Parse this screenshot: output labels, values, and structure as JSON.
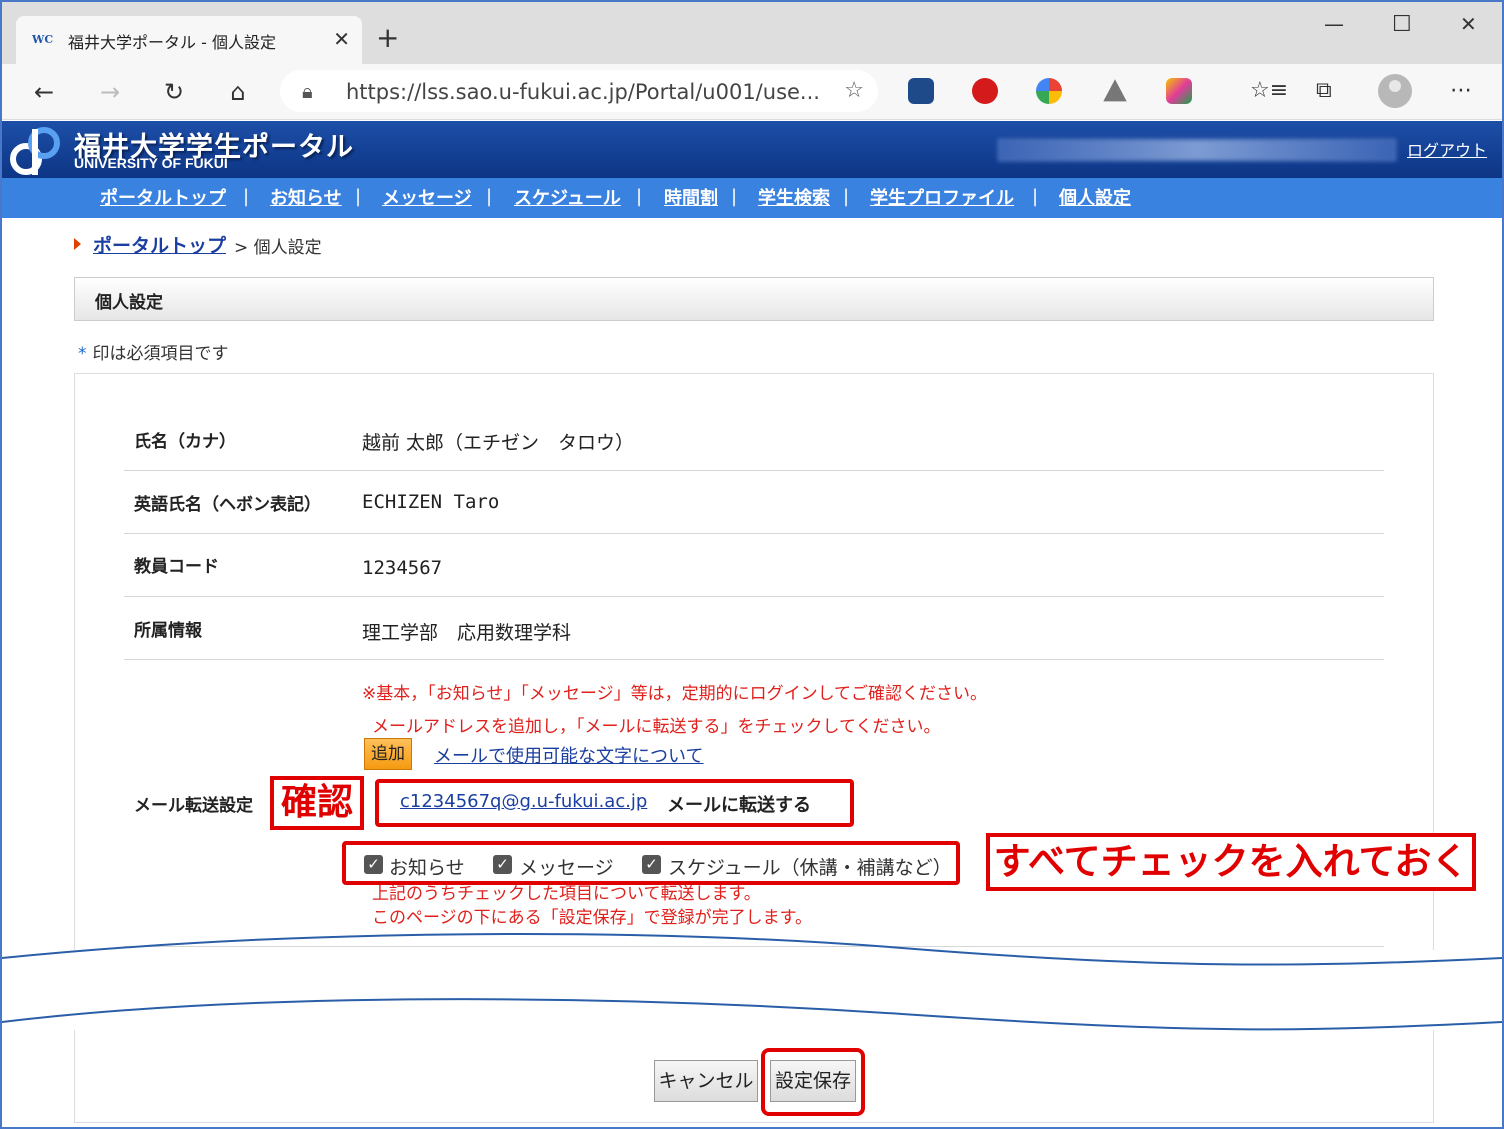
{
  "browser": {
    "tab_title": "福井大学ポータル - 個人設定",
    "favicon_text": "WC",
    "url": "https://lss.sao.u-fukui.ac.jp/Portal/u001/use..."
  },
  "portal": {
    "title": "福井大学学生ポータル",
    "subtitle": "UNIVERSITY OF FUKUI",
    "logout": "ログアウト"
  },
  "menu": [
    {
      "label": "ポータルトップ"
    },
    {
      "label": "お知らせ"
    },
    {
      "label": "メッセージ"
    },
    {
      "label": "スケジュール"
    },
    {
      "label": "時間割"
    },
    {
      "label": "学生検索"
    },
    {
      "label": "学生プロファイル"
    },
    {
      "label": "個人設定"
    }
  ],
  "breadcrumb": {
    "link": "ポータルトップ",
    "separator": ">",
    "current": "個人設定"
  },
  "section_title": "個人設定",
  "required_note": {
    "mark": "*",
    "text": "印は必須項目です"
  },
  "fields": {
    "name_kana": {
      "label": "氏名（カナ）",
      "value": "越前 太郎（エチゼン　タロウ）"
    },
    "name_en": {
      "label": "英語氏名（ヘボン表記）",
      "value": "ECHIZEN Taro"
    },
    "staff_code": {
      "label": "教員コード",
      "value": "1234567"
    },
    "affiliation": {
      "label": "所属情報",
      "value": "理工学部　応用数理学科"
    }
  },
  "mail": {
    "label": "メール転送設定",
    "notice1": "※基本，「お知らせ」「メッセージ」等は，定期的にログインしてご確認ください。",
    "notice2": "メールアドレスを追加し，「メールに転送する」をチェックしてください。",
    "add_button": "追加",
    "char_link": "メールで使用可能な文字について",
    "email": "c1234567q@g.u-fukui.ac.jp",
    "forward_label": "メールに転送する",
    "checks": [
      {
        "label": "お知らせ",
        "checked": true
      },
      {
        "label": "メッセージ",
        "checked": true
      },
      {
        "label": "スケジュール（休講・補講など）",
        "checked": true
      }
    ],
    "note3": "上記のうちチェックした項目について転送します。",
    "note4": "このページの下にある「設定保存」で登録が完了します。"
  },
  "annotations": {
    "confirm": "確認",
    "check_all": "すべてチェックを入れておく",
    "color": "#e00000"
  },
  "buttons": {
    "cancel": "キャンセル",
    "save": "設定保存"
  }
}
